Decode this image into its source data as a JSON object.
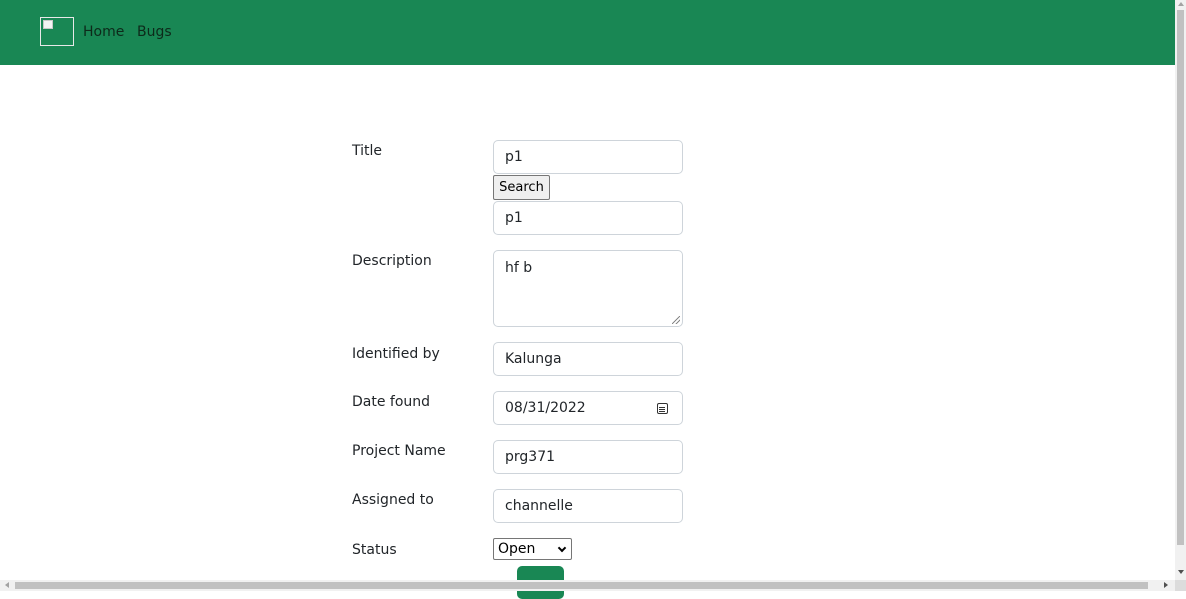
{
  "nav": {
    "home_label": "Home",
    "bugs_label": "Bugs",
    "brand_color": "#198754"
  },
  "form": {
    "title_label": "Title",
    "title_value": "p1",
    "search_button": "Search",
    "search_result_value": "p1",
    "description_label": "Description",
    "description_value": "hf b",
    "identified_by_label": "Identified by",
    "identified_by_value": "Kalunga",
    "date_found_label": "Date found",
    "date_found_value": "08/31/2022",
    "project_name_label": "Project Name",
    "project_name_value": "prg371",
    "assigned_to_label": "Assigned to",
    "assigned_to_value": "channelle",
    "status_label": "Status",
    "status_value": "Open"
  }
}
